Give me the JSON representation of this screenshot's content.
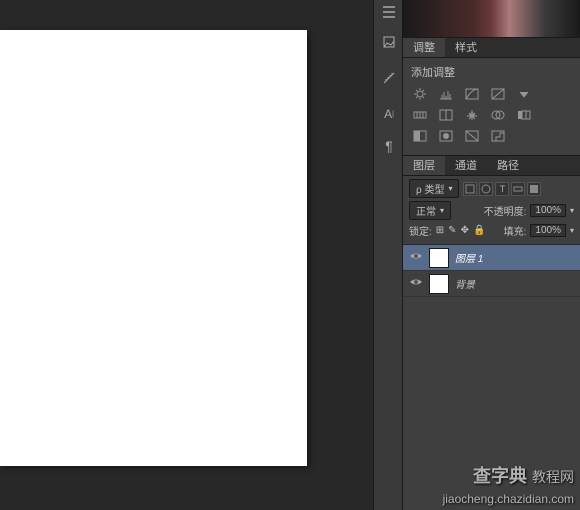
{
  "toolbar": {
    "tools": [
      "menu",
      "hand",
      "ruler",
      "text-A",
      "paragraph"
    ]
  },
  "adjustments_panel": {
    "tab_active": "调整",
    "tab_other": "样式",
    "title": "添加调整"
  },
  "layers_panel": {
    "tab_active": "图层",
    "tab_channels": "通道",
    "tab_paths": "路径",
    "kind_label": "ρ 类型",
    "blend_mode": "正常",
    "opacity_label": "不透明度:",
    "opacity_value": "100%",
    "lock_label": "锁定:",
    "fill_label": "填充:",
    "fill_value": "100%",
    "layers": [
      {
        "name": "图层 1",
        "selected": true
      },
      {
        "name": "背景",
        "selected": false
      }
    ]
  },
  "watermark": {
    "brand": "查字典",
    "suffix": "教程网",
    "url": "jiaocheng.chazidian.com"
  }
}
